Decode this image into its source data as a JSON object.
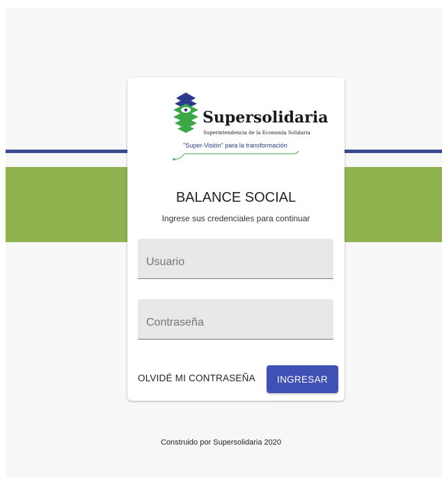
{
  "brand": {
    "name": "Supersolidaria",
    "subtitle": "Superintendencia de la Economía Solidaria",
    "tagline": "\"Super-Visión\" para la transformación"
  },
  "card": {
    "title": "BALANCE SOCIAL",
    "subtitle": "Ingrese sus credenciales para continuar"
  },
  "form": {
    "username_placeholder": "Usuario",
    "username_value": "",
    "password_placeholder": "Contraseña",
    "password_value": "",
    "forgot_label": "OLVIDÉ MI CONTRASEÑA",
    "submit_label": "INGRESAR"
  },
  "footer": {
    "text": "Construido por Supersolidaria 2020"
  },
  "colors": {
    "band_line": "#3a4a8c",
    "band_green": "#8fb24f",
    "primary_button": "#3f51b5",
    "logo_green": "#3aa845",
    "logo_blue": "#2b3a8c"
  }
}
